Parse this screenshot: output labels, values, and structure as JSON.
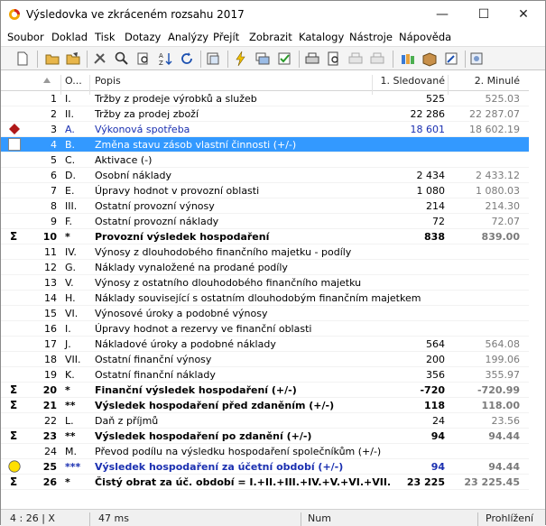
{
  "window": {
    "title": "Výsledovka ve zkráceném rozsahu 2017",
    "minimize_glyph": "—",
    "maximize_glyph": "☐",
    "close_glyph": "✕"
  },
  "menu": [
    {
      "label": "Soubor"
    },
    {
      "label": "Doklad"
    },
    {
      "label": "Tisk"
    },
    {
      "label": "Dotazy"
    },
    {
      "label": "Analýzy"
    },
    {
      "label": "Přejít"
    },
    {
      "label": "Zobrazit"
    },
    {
      "label": "Katalogy"
    },
    {
      "label": "Nástroje"
    },
    {
      "label": "Nápověda"
    }
  ],
  "toolbar": {
    "icons": [
      "new-document-icon",
      "open-folder-icon",
      "edit-folder-icon",
      "tools-icon",
      "search-icon",
      "filter-icon",
      "sort-az-icon",
      "refresh-icon",
      "export-icon",
      "lightning-icon",
      "cards-icon",
      "check-icon",
      "print-icon",
      "print-preview-icon",
      "print-disabled-icon",
      "print-setup-disabled-icon",
      "books-icon",
      "box-icon",
      "wizard-icon"
    ]
  },
  "grid": {
    "headers": {
      "code": "O...",
      "desc": "Popis",
      "v1": "1. Sledované",
      "v2": "2. Minulé"
    },
    "rows": [
      {
        "num": "1",
        "code": "I.",
        "desc": "Tržby z prodeje výrobků a služeb",
        "v1": "525",
        "v2": "525.03",
        "mark": "",
        "style": ""
      },
      {
        "num": "2",
        "code": "II.",
        "desc": "Tržby za prodej zboží",
        "v1": "22 286",
        "v2": "22 287.07",
        "mark": "",
        "style": ""
      },
      {
        "num": "3",
        "code": "A.",
        "desc": "Výkonová spotřeba",
        "v1": "18 601",
        "v2": "18 602.19",
        "mark": "diamond",
        "style": "blue"
      },
      {
        "num": "4",
        "code": "B.",
        "desc": "Změna stavu zásob vlastní činnosti (+/-)",
        "v1": "",
        "v2": "",
        "mark": "box",
        "style": "sel"
      },
      {
        "num": "5",
        "code": "C.",
        "desc": "Aktivace (-)",
        "v1": "",
        "v2": "",
        "mark": "",
        "style": ""
      },
      {
        "num": "6",
        "code": "D.",
        "desc": "Osobní náklady",
        "v1": "2 434",
        "v2": "2 433.12",
        "mark": "",
        "style": ""
      },
      {
        "num": "7",
        "code": "E.",
        "desc": "Úpravy hodnot v provozní oblasti",
        "v1": "1 080",
        "v2": "1 080.03",
        "mark": "",
        "style": ""
      },
      {
        "num": "8",
        "code": "III.",
        "desc": "Ostatní provozní výnosy",
        "v1": "214",
        "v2": "214.30",
        "mark": "",
        "style": ""
      },
      {
        "num": "9",
        "code": "F.",
        "desc": "Ostatní provozní náklady",
        "v1": "72",
        "v2": "72.07",
        "mark": "",
        "style": ""
      },
      {
        "num": "10",
        "code": "*",
        "desc": "Provozní výsledek hospodaření",
        "v1": "838",
        "v2": "839.00",
        "mark": "sigma",
        "style": "bold"
      },
      {
        "num": "11",
        "code": "IV.",
        "desc": "Výnosy z dlouhodobého finančního majetku - podíly",
        "v1": "",
        "v2": "",
        "mark": "",
        "style": ""
      },
      {
        "num": "12",
        "code": "G.",
        "desc": "Náklady vynaložené na prodané podíly",
        "v1": "",
        "v2": "",
        "mark": "",
        "style": ""
      },
      {
        "num": "13",
        "code": "V.",
        "desc": "Výnosy z ostatního dlouhodobého finančního majetku",
        "v1": "",
        "v2": "",
        "mark": "",
        "style": ""
      },
      {
        "num": "14",
        "code": "H.",
        "desc": "Náklady související s ostatním dlouhodobým finančním majetkem",
        "v1": "",
        "v2": "",
        "mark": "",
        "style": ""
      },
      {
        "num": "15",
        "code": "VI.",
        "desc": "Výnosové úroky a podobné výnosy",
        "v1": "",
        "v2": "",
        "mark": "",
        "style": ""
      },
      {
        "num": "16",
        "code": "I.",
        "desc": "Úpravy hodnot a rezervy ve finanční oblasti",
        "v1": "",
        "v2": "",
        "mark": "",
        "style": ""
      },
      {
        "num": "17",
        "code": "J.",
        "desc": "Nákladové úroky a podobné náklady",
        "v1": "564",
        "v2": "564.08",
        "mark": "",
        "style": ""
      },
      {
        "num": "18",
        "code": "VII.",
        "desc": "Ostatní finanční výnosy",
        "v1": "200",
        "v2": "199.06",
        "mark": "",
        "style": ""
      },
      {
        "num": "19",
        "code": "K.",
        "desc": "Ostatní finanční náklady",
        "v1": "356",
        "v2": "355.97",
        "mark": "",
        "style": ""
      },
      {
        "num": "20",
        "code": "*",
        "desc": "Finanční výsledek hospodaření (+/-)",
        "v1": "-720",
        "v2": "-720.99",
        "mark": "sigma",
        "style": "bold"
      },
      {
        "num": "21",
        "code": "**",
        "desc": "Výsledek hospodaření před zdaněním (+/-)",
        "v1": "118",
        "v2": "118.00",
        "mark": "sigma",
        "style": "bold"
      },
      {
        "num": "22",
        "code": "L.",
        "desc": "Daň z příjmů",
        "v1": "24",
        "v2": "23.56",
        "mark": "",
        "style": ""
      },
      {
        "num": "23",
        "code": "**",
        "desc": "Výsledek hospodaření po zdanění (+/-)",
        "v1": "94",
        "v2": "94.44",
        "mark": "sigma",
        "style": "bold"
      },
      {
        "num": "24",
        "code": "M.",
        "desc": "Převod podílu na výsledku hospodaření společníkům (+/-)",
        "v1": "",
        "v2": "",
        "mark": "",
        "style": ""
      },
      {
        "num": "25",
        "code": "***",
        "desc": "Výsledek hospodaření za účetní období (+/-)",
        "v1": "94",
        "v2": "94.44",
        "mark": "circle",
        "style": "bold blue"
      },
      {
        "num": "26",
        "code": "*",
        "desc": "Čistý obrat za úč. období = I.+II.+III.+IV.+V.+VI.+VII.",
        "v1": "23 225",
        "v2": "23 225.45",
        "mark": "sigma",
        "style": "bold"
      }
    ]
  },
  "status": {
    "position": "4 : 26 | X",
    "time": "47 ms",
    "num": "Num",
    "mode": "Prohlížení"
  },
  "colors": {
    "accent": "#3399ff",
    "blue_text": "#1a2fb0",
    "diamond": "#b01818",
    "circle": "#ffe000"
  }
}
